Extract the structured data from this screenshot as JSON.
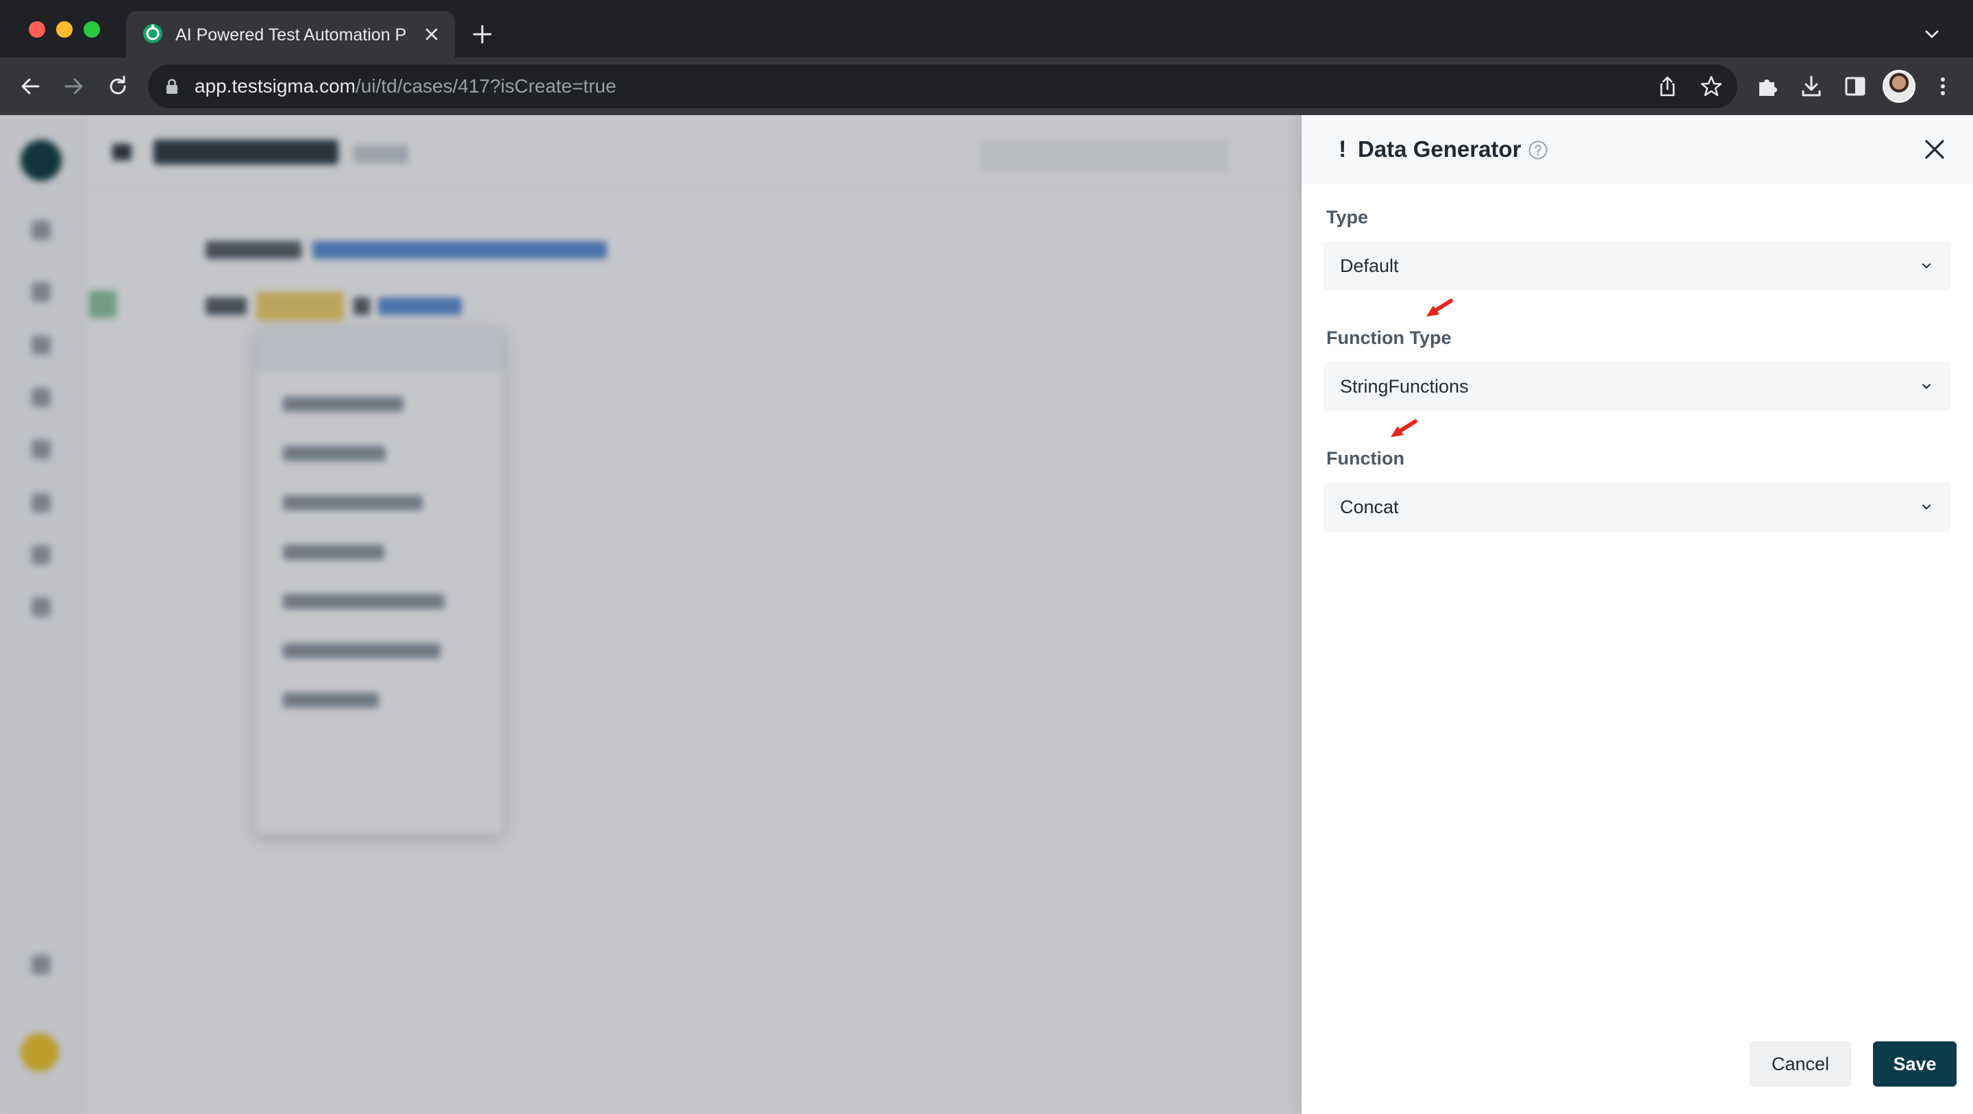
{
  "browser": {
    "tab_title": "AI Powered Test Automation P",
    "url_host": "app.testsigma.com",
    "url_path": "/ui/td/cases/417?isCreate=true",
    "tabbar_color": "#202124",
    "toolbar_color": "#35363a"
  },
  "background_app": {
    "state": "blurred behind modal drawer",
    "dropdown_item_count": 7
  },
  "drawer": {
    "title_prefix": "!",
    "title": "Data Generator",
    "fields": [
      {
        "label": "Type",
        "value": "Default"
      },
      {
        "label": "Function Type",
        "value": "StringFunctions"
      },
      {
        "label": "Function",
        "value": "Concat"
      }
    ],
    "cancel_label": "Cancel",
    "save_label": "Save",
    "save_color": "#0c3b4a"
  },
  "annotations": {
    "arrow_icon": "red-arrow-icon",
    "arrow_color": "#e8261c"
  },
  "icons": {
    "help": "question-circle-icon",
    "close": "close-icon",
    "chevron": "chevron-down-icon"
  }
}
